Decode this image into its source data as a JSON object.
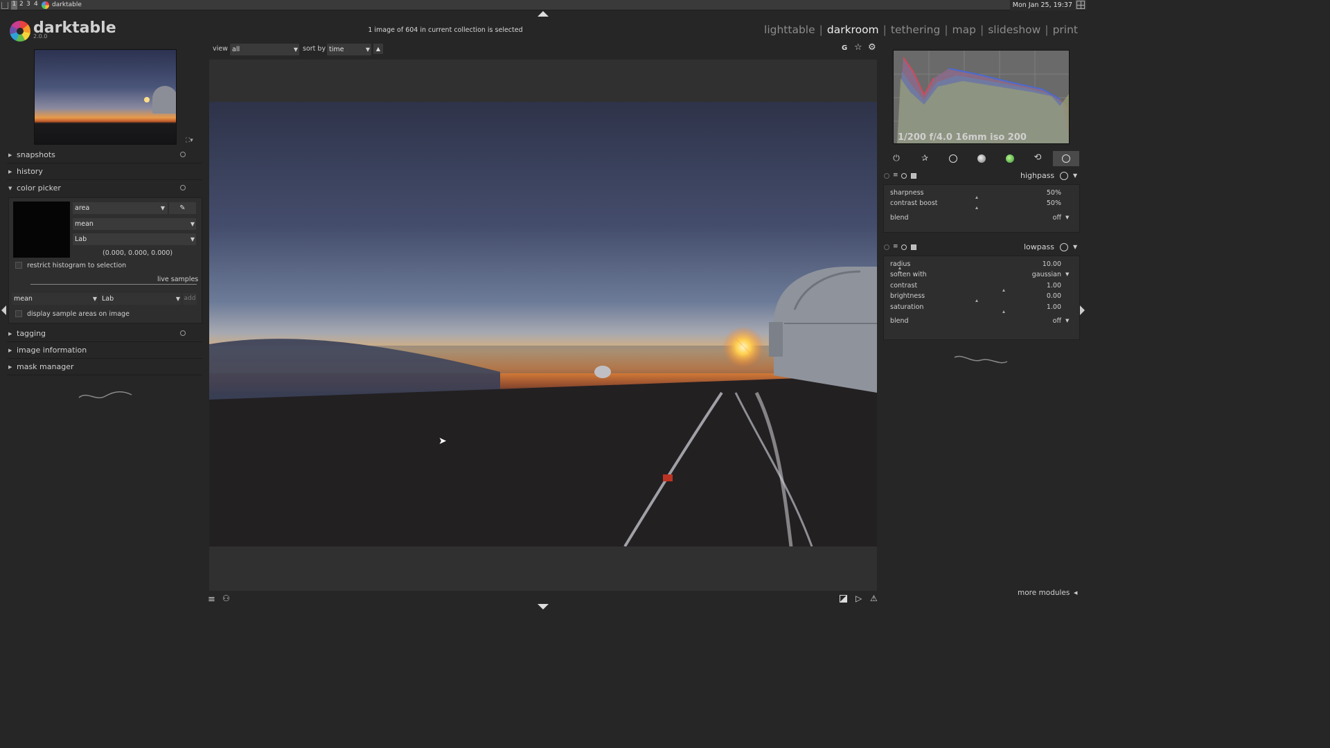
{
  "taskbar": {
    "workspaces": [
      "1",
      "2",
      "3",
      "4"
    ],
    "app_title": "darktable",
    "clock": "Mon Jan 25, 19:37"
  },
  "app": {
    "name": "darktable",
    "version": "2.0.0"
  },
  "header": {
    "collection_status": "1 image of 604 in current collection is selected",
    "views": [
      "lighttable",
      "darkroom",
      "tethering",
      "map",
      "slideshow",
      "print"
    ],
    "active_view": "darkroom"
  },
  "filmstrip_bar": {
    "view_label": "view",
    "view_value": "all",
    "sort_label": "sort by",
    "sort_value": "time",
    "right_icons": {
      "group": "G",
      "star": "☆",
      "gear": "⚙"
    }
  },
  "left_panel": {
    "sections": {
      "snapshots": "snapshots",
      "history": "history",
      "color_picker": "color picker",
      "tagging": "tagging",
      "image_information": "image information",
      "mask_manager": "mask manager"
    },
    "color_picker": {
      "mode": "area",
      "statistic": "mean",
      "color_space": "Lab",
      "swatch_color": "#050505",
      "values": "(0.000, 0.000, 0.000)",
      "restrict_histogram_label": "restrict histogram to selection",
      "live_samples_label": "live samples",
      "sample_statistic": "mean",
      "sample_color_space": "Lab",
      "add_label": "add",
      "display_sample_areas_label": "display sample areas on image"
    }
  },
  "right_panel": {
    "histogram_info": "1/200 f/4.0 16mm iso 200",
    "module_groups": [
      "power-icon",
      "star-icon",
      "circle-icon",
      "half-circle-icon",
      "color-circle-icon",
      "refresh-icon",
      "effects-icon"
    ],
    "highpass": {
      "title": "highpass",
      "params": [
        {
          "label": "sharpness",
          "value": "50%",
          "level": 0.5
        },
        {
          "label": "contrast boost",
          "value": "50%",
          "level": 0.5
        }
      ],
      "blend_label": "blend",
      "blend_value": "off"
    },
    "lowpass": {
      "title": "lowpass",
      "radius_label": "radius",
      "radius_value": "10.00",
      "soften_label": "soften with",
      "soften_value": "gaussian",
      "params": [
        {
          "label": "contrast",
          "value": "1.00",
          "level": 0.66
        },
        {
          "label": "brightness",
          "value": "0.00",
          "level": 0.5
        },
        {
          "label": "saturation",
          "value": "1.00",
          "level": 0.66
        }
      ],
      "blend_label": "blend",
      "blend_value": "off"
    },
    "more_modules_label": "more modules"
  },
  "colors": {
    "accent_text": "#ececec",
    "panel_bg": "#262626",
    "center_bg": "#303030"
  }
}
